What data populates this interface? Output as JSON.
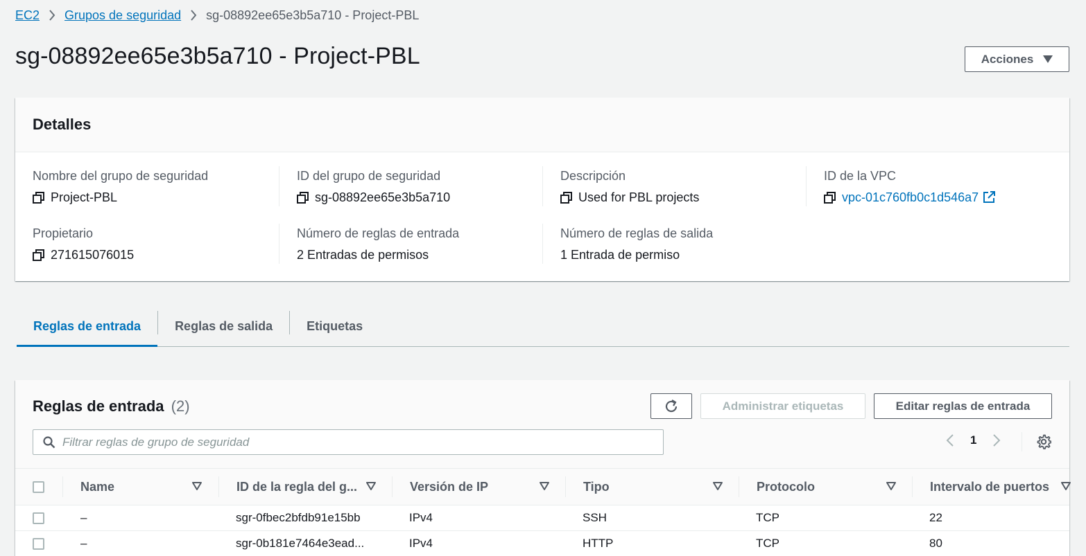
{
  "breadcrumb": {
    "ec2": "EC2",
    "groups": "Grupos de seguridad",
    "current": "sg-08892ee65e3b5a710 - Project-PBL"
  },
  "page": {
    "title": "sg-08892ee65e3b5a710 - Project-PBL",
    "actions_label": "Acciones"
  },
  "details": {
    "title": "Detalles",
    "group_name_label": "Nombre del grupo de seguridad",
    "group_name_value": "Project-PBL",
    "group_id_label": "ID del grupo de seguridad",
    "group_id_value": "sg-08892ee65e3b5a710",
    "description_label": "Descripción",
    "description_value": "Used for PBL projects",
    "vpc_label": "ID de la VPC",
    "vpc_value": "vpc-01c760fb0c1d546a7",
    "owner_label": "Propietario",
    "owner_value": "271615076015",
    "inbound_count_label": "Número de reglas de entrada",
    "inbound_count_value": "2 Entradas de permisos",
    "outbound_count_label": "Número de reglas de salida",
    "outbound_count_value": "1 Entrada de permiso"
  },
  "tabs": [
    {
      "label": "Reglas de entrada",
      "active": true
    },
    {
      "label": "Reglas de salida",
      "active": false
    },
    {
      "label": "Etiquetas",
      "active": false
    }
  ],
  "rules": {
    "title": "Reglas de entrada",
    "count": "(2)",
    "manage_tags_label": "Administrar etiquetas",
    "edit_rules_label": "Editar reglas de entrada",
    "search_placeholder": "Filtrar reglas de grupo de seguridad",
    "page": "1",
    "columns": [
      "Name",
      "ID de la regla del g...",
      "Versión de IP",
      "Tipo",
      "Protocolo",
      "Intervalo de puertos"
    ],
    "rows": [
      [
        "–",
        "sgr-0fbec2bfdb91e15bb",
        "IPv4",
        "SSH",
        "TCP",
        "22"
      ],
      [
        "–",
        "sgr-0b181e7464e3ead...",
        "IPv4",
        "HTTP",
        "TCP",
        "80"
      ]
    ]
  },
  "colors": {
    "link": "#0073bb",
    "background": "#f2f3f3",
    "disabled": "#aab7b8"
  }
}
